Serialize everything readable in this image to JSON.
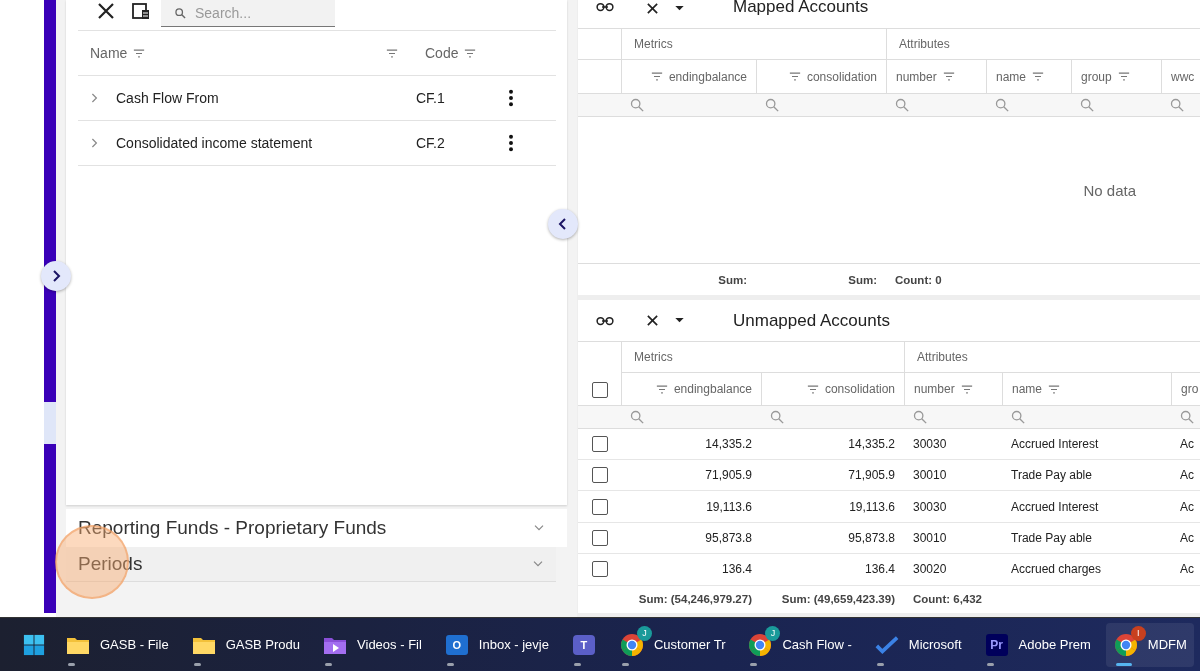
{
  "left_panel": {
    "search": {
      "placeholder": "Search..."
    },
    "tree": {
      "columns": [
        {
          "label": "Name",
          "filterable": true
        },
        {
          "filterable": true
        },
        {
          "label": "Code",
          "filterable": true
        }
      ],
      "rows": [
        {
          "name": "Cash Flow From",
          "code": "CF.1",
          "expanded": false
        },
        {
          "name": "Consolidated income statement",
          "code": "CF.2",
          "expanded": false
        }
      ]
    },
    "sections": [
      {
        "title": "Reporting Funds - Proprietary Funds",
        "selected": false
      },
      {
        "title": "Periods",
        "selected": true
      }
    ]
  },
  "mapped_accounts": {
    "title": "Mapped Accounts",
    "groups": [
      {
        "label": "Metrics",
        "kind": "metric"
      },
      {
        "label": "Attributes",
        "kind": "attribute"
      }
    ],
    "columns": [
      {
        "label": "endingbalance",
        "kind": "metric",
        "filterable": true
      },
      {
        "label": "consolidation",
        "kind": "metric",
        "filterable": true
      },
      {
        "label": "number",
        "kind": "attribute",
        "filterable": true
      },
      {
        "label": "name",
        "kind": "attribute",
        "filterable": true
      },
      {
        "label": "group",
        "kind": "attribute",
        "filterable": true
      },
      {
        "label": "wwc",
        "kind": "attribute"
      }
    ],
    "empty_text": "No data",
    "footer": [
      "Sum:",
      "Sum:",
      "Count: 0"
    ]
  },
  "unmapped_accounts": {
    "title": "Unmapped Accounts",
    "select_all": {
      "checked": false
    },
    "groups": [
      {
        "label": "Metrics",
        "kind": "metric"
      },
      {
        "label": "Attributes",
        "kind": "attribute"
      }
    ],
    "columns": [
      {
        "label": "endingbalance",
        "kind": "metric",
        "filterable": true
      },
      {
        "label": "consolidation",
        "kind": "metric",
        "filterable": true
      },
      {
        "label": "number",
        "kind": "attribute",
        "filterable": true
      },
      {
        "label": "name",
        "kind": "attribute",
        "filterable": true
      },
      {
        "label": "gro",
        "kind": "attribute"
      }
    ],
    "rows": [
      {
        "checked": false,
        "cells": [
          "14,335.2",
          "14,335.2",
          "30030",
          "Accrued Interest",
          "Ac"
        ]
      },
      {
        "checked": false,
        "cells": [
          "71,905.9",
          "71,905.9",
          "30010",
          "Trade Pay able",
          "Ac"
        ]
      },
      {
        "checked": false,
        "cells": [
          "19,113.6",
          "19,113.6",
          "30030",
          "Accrued Interest",
          "Ac"
        ]
      },
      {
        "checked": false,
        "cells": [
          "95,873.8",
          "95,873.8",
          "30010",
          "Trade Pay able",
          "Ac"
        ]
      },
      {
        "checked": false,
        "cells": [
          "136.4",
          "136.4",
          "30020",
          "Accrued charges",
          "Ac"
        ]
      }
    ],
    "footer": [
      "Sum: (54,246,979.27)",
      "Sum: (49,659,423.39)",
      "Count: 6,432"
    ]
  },
  "taskbar": [
    {
      "kind": "start",
      "selected": false
    },
    {
      "kind": "folder",
      "label": "GASB - File",
      "selected": false
    },
    {
      "kind": "folder",
      "label": "GASB Produ",
      "selected": false
    },
    {
      "kind": "video-folder",
      "label": "Videos - Fil",
      "selected": false
    },
    {
      "kind": "mail",
      "label": "Inbox - jevje",
      "icon_text": "O",
      "selected": false
    },
    {
      "kind": "chat",
      "icon_text": "T",
      "selected": false
    },
    {
      "kind": "browser",
      "label": "Customer Tr",
      "badge": "J",
      "color": "#1a9a9a",
      "selected": false
    },
    {
      "kind": "browser",
      "label": "Cash Flow -",
      "badge": "J",
      "color": "#1a9a9a",
      "selected": false
    },
    {
      "kind": "checkmark",
      "label": "Microsoft",
      "selected": false
    },
    {
      "kind": "video-editor",
      "label": "Adobe Prem",
      "icon_text": "Pr",
      "selected": false
    },
    {
      "kind": "browser",
      "label": "MDFM",
      "badge": "I",
      "color": "#c8401e",
      "selected": true
    }
  ]
}
